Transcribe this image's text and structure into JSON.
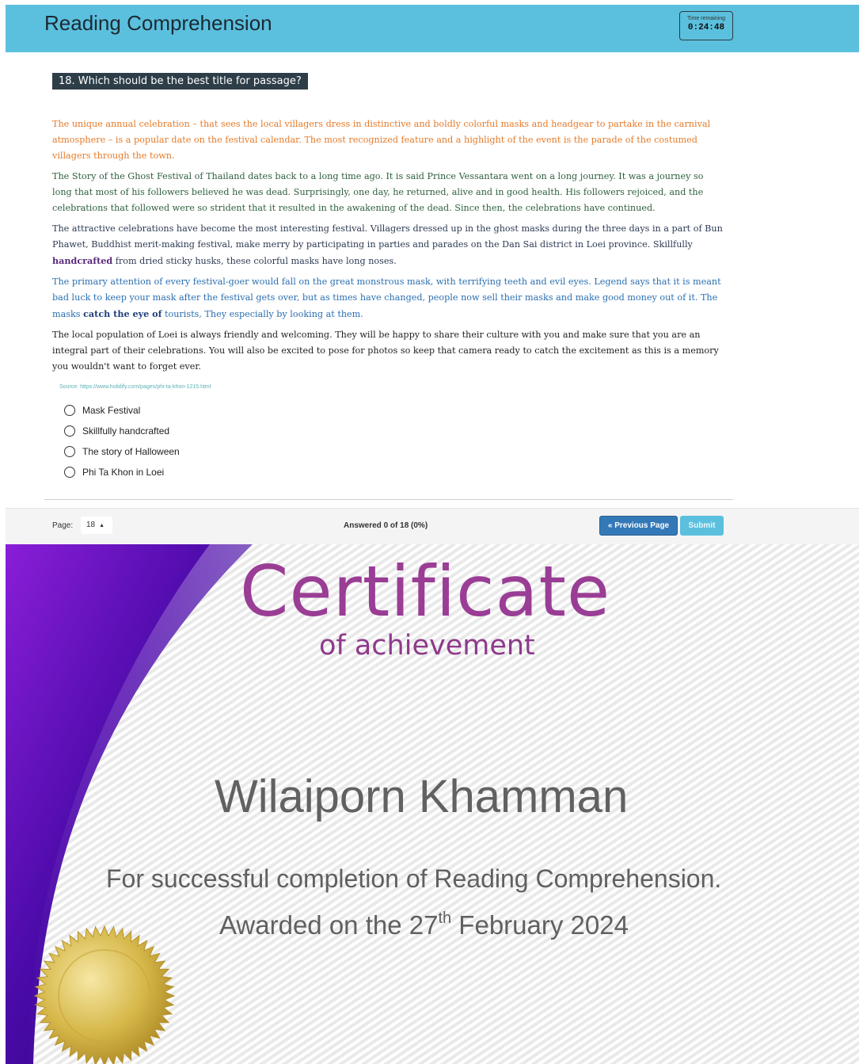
{
  "quiz": {
    "title": "Reading Comprehension",
    "timer": {
      "label": "Time remaining",
      "value": "0:24:48"
    },
    "question": "18. Which should be the best title for passage?",
    "passage": {
      "p1": "The unique annual celebration – that sees the local villagers dress in distinctive and boldly colorful masks and headgear to partake in the carnival atmosphere – is a popular date on the festival calendar. The most recognized feature and a highlight of the event is the parade of the costumed villagers through the town.",
      "p2": "The Story of the Ghost Festival of Thailand dates back to a long time ago. It is said Prince Vessantara went on a long journey. It was a journey so long that most of his followers believed he was dead. Surprisingly, one day, he returned, alive and in good health. His followers rejoiced, and the celebrations that followed were so strident that it resulted in the awakening of the dead. Since then, the celebrations have continued.",
      "p3_before": "The attractive celebrations have become the most interesting festival. Villagers dressed up in the ghost masks during the three days in a part of Bun Phawet, Buddhist merit-making festival, make merry by participating in parties and parades on the Dan Sai district in Loei province. Skillfully ",
      "p3_bold": "handcrafted",
      "p3_after": " from dried sticky husks, these colorful masks have long noses.",
      "p4_before": "The primary attention of every festival-goer would fall on the great monstrous mask, with terrifying teeth and evil eyes. Legend says that it is meant bad luck to keep your mask after the festival gets over, but as times have changed, people now sell their masks and make good money out of it. The masks ",
      "p4_bold": "catch the eye of",
      "p4_after": " tourists, They especially by looking at them.",
      "p5": "The local population of Loei is always friendly and welcoming. They will be happy to share their culture with you and make sure that you are an integral part of their celebrations. You will also be excited to pose for photos so keep that camera ready to catch the excitement as this is a memory you wouldn't want to forget ever."
    },
    "source": "Source: https://www.holidify.com/pages/phi-ta-khon-1215.html",
    "options": [
      "Mask Festival",
      "Skillfully handcrafted",
      "The story of Halloween",
      "Phi Ta Khon in Loei"
    ],
    "footer": {
      "page_label": "Page:",
      "page_value": "18",
      "answered": "Answered 0 of 18 (0%)",
      "prev_button": "« Previous Page",
      "submit_button": "Submit"
    }
  },
  "certificate": {
    "title": "Certificate",
    "subtitle": "of achievement",
    "recipient": "Wilaiporn Khamman",
    "description": "For successful completion of Reading Comprehension.",
    "date_prefix": "Awarded on the 27",
    "date_suffix": "th",
    "date_rest": " February 2024"
  },
  "colors": {
    "header_bg": "#5bc0de",
    "question_banner_bg": "#2e3e48",
    "prev_button_bg": "#3479b7",
    "submit_button_bg": "#5bc0de",
    "certificate_title": "#9a3d95",
    "swoosh_purple": "#6a0fbf",
    "seal_gold": "#d6b84a"
  }
}
